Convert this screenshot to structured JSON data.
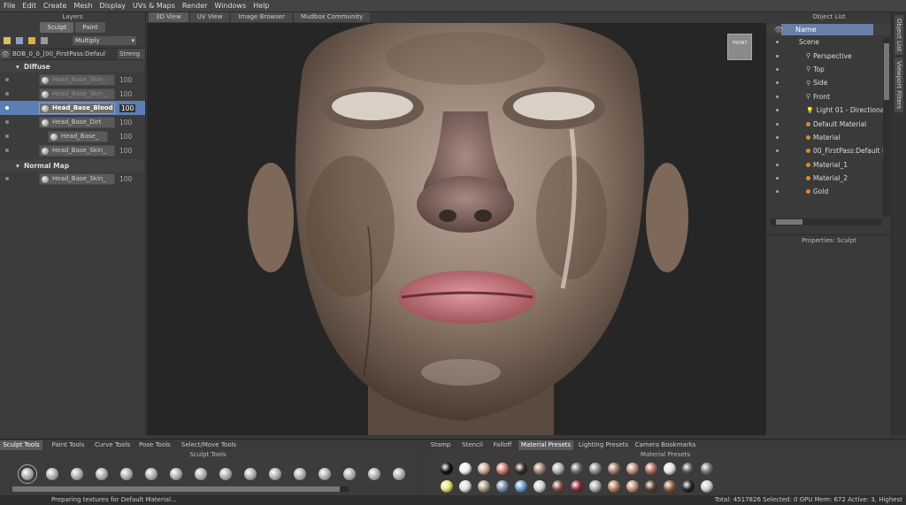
{
  "menu": [
    "File",
    "Edit",
    "Create",
    "Mesh",
    "Display",
    "UVs & Maps",
    "Render",
    "Windows",
    "Help"
  ],
  "layers": {
    "title": "Layers",
    "tabs": [
      "Sculpt",
      "Paint"
    ],
    "blend_mode": "Multiply",
    "header_name": "BOB_0_0_[00_FirstPass:Defaul",
    "header_strength": "Streng",
    "groups": [
      {
        "name": "Diffuse"
      },
      {
        "name": "Normal Map"
      }
    ],
    "rows": [
      {
        "name": "Head_Base_Skin_",
        "value": "100"
      },
      {
        "name": "Head_Base_Skin_",
        "value": "100"
      },
      {
        "name": "Head_Base_Blood",
        "value": "100"
      },
      {
        "name": "Head_Base_Dirt",
        "value": "100"
      },
      {
        "name": "Head_Base_",
        "value": "100"
      },
      {
        "name": "Head_Base_Skin_",
        "value": "100"
      },
      {
        "name": "Head_Base_Skin_",
        "value": "100"
      }
    ]
  },
  "viewport": {
    "tabs": [
      "3D View",
      "UV View",
      "Image Browser",
      "Mudbox Community"
    ],
    "cube_label": "FRONT"
  },
  "object_list": {
    "title": "Object List",
    "header": "Name",
    "items": [
      {
        "label": "Scene"
      },
      {
        "label": "Perspective"
      },
      {
        "label": "Top"
      },
      {
        "label": "Side"
      },
      {
        "label": "Front"
      },
      {
        "label": "Light 01 - Directional"
      },
      {
        "label": "Default Material"
      },
      {
        "label": "Material"
      },
      {
        "label": "00_FirstPass:Default M"
      },
      {
        "label": "Material_1"
      },
      {
        "label": "Material_2"
      },
      {
        "label": "Gold"
      }
    ],
    "properties_title": "Properties: Sculpt"
  },
  "side_tabs": [
    "Object List",
    "Viewport Filters"
  ],
  "bottom": {
    "left_tabs": [
      "Sculpt Tools",
      "Paint Tools",
      "Curve Tools",
      "Pose Tools",
      "Select/Move Tools"
    ],
    "right_tabs": [
      "Stamp",
      "Stencil",
      "Falloff",
      "Material Presets",
      "Lighting Presets",
      "Camera Bookmarks"
    ],
    "tool_title": "Sculpt Tools",
    "material_title": "Material Presets"
  },
  "status": {
    "left": "Preparing textures for Default Material...",
    "right": "Total: 4517826  Selected: 0  GPU Mem: 672  Active: 3, Highest"
  },
  "colors": {
    "selection": "#5b7fb5",
    "accent": "#d88a3a"
  }
}
